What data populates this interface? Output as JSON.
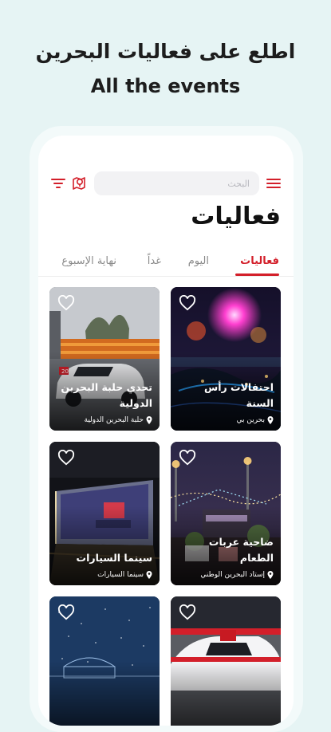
{
  "promo": {
    "headline_ar": "اطلع على فعاليات البحرين",
    "headline_en": "All the events"
  },
  "search": {
    "placeholder": "البحث"
  },
  "page": {
    "title": "فعاليات"
  },
  "tabs": [
    {
      "label": "فعاليات",
      "active": true
    },
    {
      "label": "اليوم",
      "active": false
    },
    {
      "label": "غداً",
      "active": false
    },
    {
      "label": "نهاية الإسبوع",
      "active": false
    }
  ],
  "events": [
    {
      "title": "احتفالات رأس السنة",
      "location": "بحرين بي"
    },
    {
      "title": "تحدي حلبة البحرين الدولية",
      "location": "حلبة البحرين الدولية"
    },
    {
      "title": "ضاحية عربات الطعام",
      "location": "إستاد البحرين الوطني"
    },
    {
      "title": "سينما السيارات",
      "location": "سينما السيارات"
    },
    {
      "title": "",
      "location": ""
    },
    {
      "title": "",
      "location": ""
    }
  ],
  "colors": {
    "accent": "#d31f2a",
    "background": "#e6f4f4"
  },
  "icons": {
    "menu": "hamburger-menu-icon",
    "map": "map-pin-icon",
    "filter": "filter-icon",
    "favorite": "heart-outline-icon",
    "location": "location-pin-icon"
  }
}
